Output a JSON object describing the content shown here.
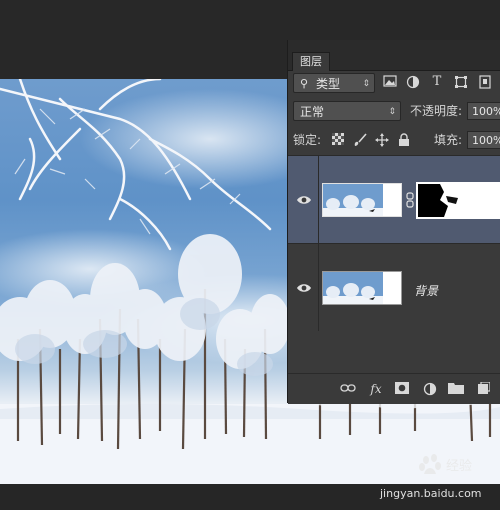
{
  "layers_panel": {
    "tab_label": "图层",
    "filter": {
      "value": "类型",
      "icons": [
        "image-filter-icon",
        "adjustment-filter-icon",
        "type-filter-icon",
        "shape-filter-icon",
        "smart-object-filter-icon"
      ],
      "type_glyph": "T"
    },
    "blend_mode": {
      "value": "正常"
    },
    "opacity": {
      "label": "不透明度:",
      "value": "100%"
    },
    "lock": {
      "label": "锁定:",
      "icons": [
        "lock-transparent-icon",
        "lock-paint-icon",
        "lock-position-icon",
        "lock-all-icon"
      ]
    },
    "fill": {
      "label": "填充:",
      "value": "100%"
    },
    "layers": [
      {
        "name": "",
        "selected": true,
        "has_mask": true,
        "visible": true
      },
      {
        "name": "背景",
        "selected": false,
        "has_mask": false,
        "visible": true
      }
    ],
    "footer_icons": [
      "link-layers-icon",
      "fx-icon",
      "add-mask-icon",
      "adjustment-layer-icon",
      "new-group-icon",
      "new-layer-icon"
    ],
    "fx_label": "fx"
  },
  "watermark": {
    "url": "jingyan.baidu.com",
    "logo": "Baidu 经验"
  },
  "colors": {
    "panel": "#3a3a3a",
    "selected_layer": "#505a70",
    "dark_bg": "#262626",
    "sky": "#5f92c8"
  }
}
